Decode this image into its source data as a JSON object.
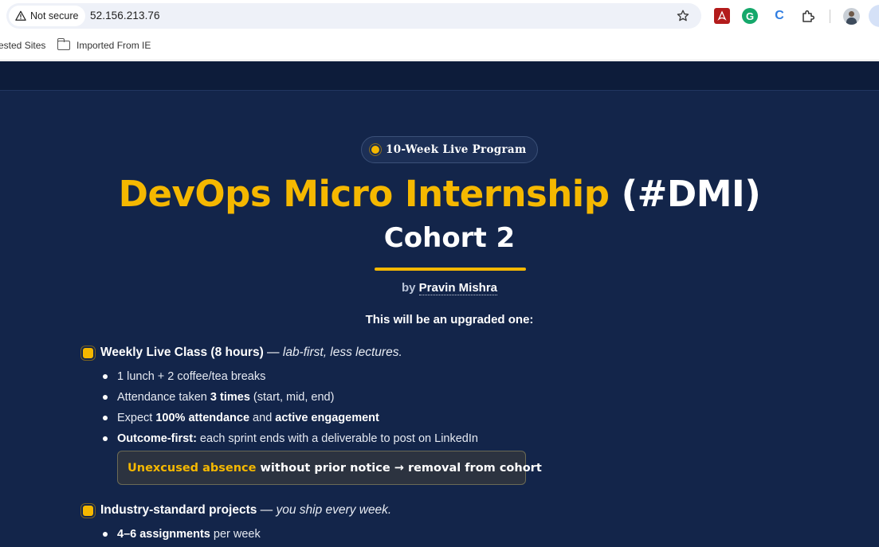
{
  "browser": {
    "security_label": "Not secure",
    "url": "52.156.213.76",
    "bookmarks": [
      "ested Sites",
      "Imported From IE"
    ]
  },
  "hero": {
    "badge": "10-Week Live Program",
    "title_highlight": "DevOps Micro Internship",
    "title_suffix": "(#DMI)",
    "subtitle": "Cohort 2",
    "by": "by",
    "author": "Pravin Mishra",
    "intro": "This will be an upgraded one:"
  },
  "sections": [
    {
      "heading": "Weekly Live Class (8 hours)",
      "dash": " — ",
      "tagline": "lab-first, less lectures.",
      "items": [
        {
          "text": "1 lunch + 2 coffee/tea breaks"
        },
        {
          "pre": "Attendance taken ",
          "bold": "3 times",
          "post": " (start, mid, end)"
        },
        {
          "pre": "Expect ",
          "bold": "100% attendance",
          "mid": " and ",
          "bold2": "active engagement"
        },
        {
          "bold": "Outcome-first:",
          "post": " each sprint ends with a deliverable to post on LinkedIn"
        }
      ],
      "callout": {
        "highlight": "Unexcused absence",
        "rest": " without prior notice → removal from cohort"
      }
    },
    {
      "heading": "Industry-standard projects",
      "dash": " — ",
      "tagline": "you ship every week.",
      "items": [
        {
          "bold": "4–6 assignments",
          "post": " per week"
        }
      ]
    }
  ],
  "colors": {
    "page_bg": "#13254a",
    "accent": "#f5b800",
    "nav_bg": "#0d1c3a"
  }
}
